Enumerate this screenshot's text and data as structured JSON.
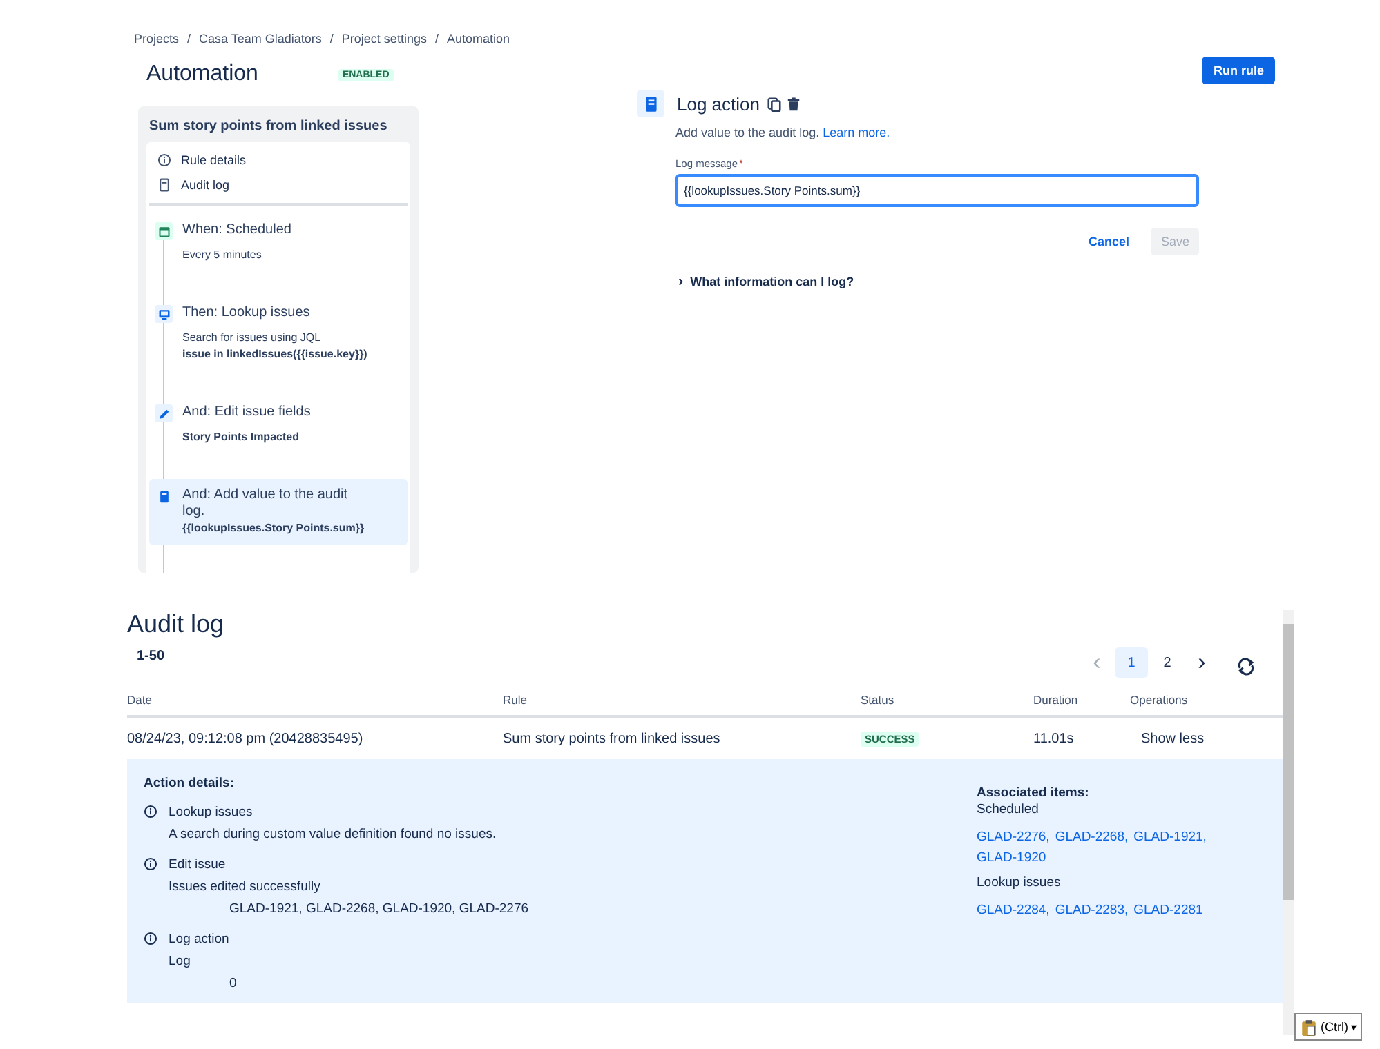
{
  "breadcrumbs": [
    "Projects",
    "Casa Team Gladiators",
    "Project settings",
    "Automation"
  ],
  "breadcrumb_separator": "/",
  "page_title": "Automation",
  "status_lozenge": "ENABLED",
  "run_button": "Run rule",
  "rule_panel": {
    "title": "Sum story points from linked issues",
    "menu": [
      {
        "kind": "info",
        "label": "Rule details"
      },
      {
        "kind": "log",
        "label": "Audit log"
      }
    ],
    "steps": [
      {
        "kind": "trigger",
        "title": "When: Scheduled",
        "lines": [
          "Every 5 minutes"
        ],
        "selected": false
      },
      {
        "kind": "lookup",
        "title": "Then: Lookup issues",
        "lines": [
          "Search for issues using JQL",
          "**issue in linkedIssues({{issue.key}})**"
        ],
        "selected": false
      },
      {
        "kind": "edit",
        "title": "And: Edit issue fields",
        "lines": [
          "**Story Points Impacted**"
        ],
        "selected": false
      },
      {
        "kind": "log",
        "title": "And: Add value to the audit log.",
        "lines": [
          "**{{lookupIssues.Story Points.sum}}**"
        ],
        "selected": true
      }
    ]
  },
  "editor": {
    "title": "Log action",
    "description": "Add value to the audit log.",
    "learn_more": "Learn more.",
    "field_label": "Log message",
    "required_mark": "*",
    "field_value": "{{lookupIssues.Story Points.sum}}",
    "cancel": "Cancel",
    "save": "Save",
    "save_disabled": true,
    "expander": "What information can I log?",
    "expander_glyph": "›"
  },
  "audit_log": {
    "title": "Audit log",
    "range": "1-50",
    "pagination": {
      "prev": "‹",
      "next": "›",
      "pages": [
        {
          "label": "1",
          "selected": true
        },
        {
          "label": "2",
          "selected": false
        }
      ]
    },
    "columns": [
      "Date",
      "Rule",
      "Status",
      "Duration",
      "Operations"
    ],
    "rows": [
      {
        "date": "08/24/23, 09:12:08 pm (20428835495)",
        "rule": "Sum story points from linked issues",
        "status": "SUCCESS",
        "duration": "11.01s",
        "operation": "Show less",
        "expanded": true
      }
    ],
    "details": {
      "title": "Action details:",
      "actions": [
        {
          "name": "Lookup issues",
          "lines": [
            "A search during custom value definition found no issues."
          ]
        },
        {
          "name": "Edit issue",
          "lines": [
            "Issues edited successfully"
          ],
          "indented": [
            "GLAD-1921, GLAD-2268, GLAD-1920, GLAD-2276"
          ]
        },
        {
          "name": "Log action",
          "lines": [
            "Log"
          ],
          "indented": [
            "0"
          ]
        }
      ],
      "associated_title": "Associated items:",
      "groups": [
        {
          "name": "Scheduled",
          "links": [
            "GLAD-2276,",
            "GLAD-2268,",
            "GLAD-1921,",
            "GLAD-1920"
          ]
        },
        {
          "name": "Lookup issues",
          "links": [
            "GLAD-2284,",
            "GLAD-2283,",
            "GLAD-2281"
          ]
        }
      ]
    }
  },
  "paste_button": "(Ctrl)",
  "paste_caret": "▾"
}
